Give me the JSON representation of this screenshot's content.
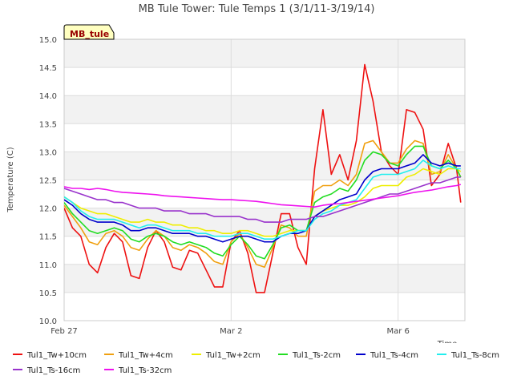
{
  "chart_data": {
    "type": "line",
    "title": "MB Tule Tower: Tule Temps 1 (3/1/11-3/19/14)",
    "xlabel": "Time",
    "ylabel": "Temperature (C)",
    "ylim": [
      10.0,
      15.0
    ],
    "xlim": [
      0,
      9.6
    ],
    "yticks": [
      "10.0",
      "10.5",
      "11.0",
      "11.5",
      "12.0",
      "12.5",
      "13.0",
      "13.5",
      "14.0",
      "14.5",
      "15.0"
    ],
    "xticks": [
      {
        "value": 0,
        "label": "Feb 27"
      },
      {
        "value": 4,
        "label": "Mar 2"
      },
      {
        "value": 8,
        "label": "Mar 6"
      }
    ],
    "grid": true,
    "station_badge": "MB_tule",
    "legend_position": "bottom",
    "x": [
      0.0,
      0.2,
      0.4,
      0.6,
      0.8,
      1.0,
      1.2,
      1.4,
      1.6,
      1.8,
      2.0,
      2.2,
      2.4,
      2.6,
      2.8,
      3.0,
      3.2,
      3.4,
      3.6,
      3.8,
      4.0,
      4.2,
      4.4,
      4.6,
      4.8,
      5.0,
      5.2,
      5.4,
      5.6,
      5.8,
      6.0,
      6.2,
      6.4,
      6.6,
      6.8,
      7.0,
      7.2,
      7.4,
      7.6,
      7.8,
      8.0,
      8.2,
      8.4,
      8.6,
      8.8,
      9.0,
      9.2,
      9.4,
      9.5
    ],
    "series": [
      {
        "name": "Tul1_Tw+10cm",
        "color": "#ee1111",
        "values": [
          12.0,
          11.65,
          11.5,
          11.0,
          10.85,
          11.3,
          11.55,
          11.4,
          10.8,
          10.75,
          11.3,
          11.6,
          11.4,
          10.95,
          10.9,
          11.25,
          11.2,
          10.9,
          10.6,
          10.6,
          11.4,
          11.6,
          11.2,
          10.5,
          10.5,
          11.2,
          11.9,
          11.9,
          11.3,
          11.0,
          12.7,
          13.75,
          12.6,
          12.95,
          12.5,
          13.2,
          14.55,
          13.9,
          13.0,
          12.75,
          12.6,
          13.75,
          13.7,
          13.4,
          12.4,
          12.6,
          13.15,
          12.7,
          12.1
        ]
      },
      {
        "name": "Tul1_Tw+4cm",
        "color": "#f0a010",
        "values": [
          12.05,
          11.85,
          11.65,
          11.4,
          11.35,
          11.55,
          11.6,
          11.5,
          11.3,
          11.25,
          11.45,
          11.6,
          11.5,
          11.3,
          11.25,
          11.35,
          11.3,
          11.2,
          11.05,
          11.0,
          11.4,
          11.55,
          11.3,
          11.0,
          10.95,
          11.3,
          11.7,
          11.65,
          11.5,
          11.5,
          12.3,
          12.4,
          12.4,
          12.5,
          12.4,
          12.6,
          13.15,
          13.2,
          13.0,
          12.8,
          12.8,
          13.05,
          13.2,
          13.15,
          12.6,
          12.65,
          12.95,
          12.7,
          12.55
        ]
      },
      {
        "name": "Tul1_Tw+2cm",
        "color": "#eeee00",
        "values": [
          12.2,
          12.1,
          12.0,
          11.95,
          11.9,
          11.9,
          11.85,
          11.8,
          11.75,
          11.75,
          11.8,
          11.75,
          11.75,
          11.7,
          11.7,
          11.65,
          11.65,
          11.6,
          11.6,
          11.55,
          11.55,
          11.6,
          11.6,
          11.55,
          11.5,
          11.5,
          11.55,
          11.6,
          11.6,
          11.6,
          11.85,
          11.95,
          12.0,
          12.05,
          12.05,
          12.1,
          12.2,
          12.35,
          12.4,
          12.4,
          12.4,
          12.55,
          12.6,
          12.7,
          12.65,
          12.6,
          12.7,
          12.7,
          12.65
        ]
      },
      {
        "name": "Tul1_Ts-2cm",
        "color": "#22dd22",
        "values": [
          12.1,
          11.9,
          11.75,
          11.6,
          11.55,
          11.6,
          11.65,
          11.6,
          11.45,
          11.4,
          11.5,
          11.55,
          11.5,
          11.4,
          11.35,
          11.4,
          11.35,
          11.3,
          11.2,
          11.15,
          11.35,
          11.5,
          11.35,
          11.15,
          11.1,
          11.35,
          11.65,
          11.7,
          11.6,
          11.6,
          12.1,
          12.2,
          12.25,
          12.35,
          12.3,
          12.5,
          12.85,
          13.0,
          12.95,
          12.8,
          12.75,
          12.95,
          13.1,
          13.1,
          12.75,
          12.7,
          12.85,
          12.7,
          12.55
        ]
      },
      {
        "name": "Tul1_Ts-4cm",
        "color": "#0000cc",
        "values": [
          12.15,
          12.05,
          11.9,
          11.8,
          11.75,
          11.75,
          11.75,
          11.7,
          11.6,
          11.6,
          11.65,
          11.65,
          11.6,
          11.55,
          11.55,
          11.55,
          11.5,
          11.5,
          11.45,
          11.4,
          11.45,
          11.5,
          11.5,
          11.45,
          11.4,
          11.4,
          11.5,
          11.55,
          11.55,
          11.6,
          11.85,
          11.95,
          12.05,
          12.15,
          12.2,
          12.25,
          12.5,
          12.65,
          12.7,
          12.7,
          12.7,
          12.75,
          12.8,
          12.95,
          12.8,
          12.75,
          12.8,
          12.75,
          12.75
        ]
      },
      {
        "name": "Tul1_Ts-8cm",
        "color": "#22eeee",
        "values": [
          12.2,
          12.1,
          11.95,
          11.85,
          11.8,
          11.8,
          11.8,
          11.75,
          11.7,
          11.65,
          11.7,
          11.7,
          11.65,
          11.6,
          11.6,
          11.6,
          11.55,
          11.55,
          11.5,
          11.5,
          11.5,
          11.55,
          11.55,
          11.5,
          11.45,
          11.45,
          11.5,
          11.55,
          11.6,
          11.6,
          11.8,
          11.9,
          11.95,
          12.05,
          12.1,
          12.15,
          12.35,
          12.55,
          12.6,
          12.6,
          12.6,
          12.65,
          12.7,
          12.85,
          12.75,
          12.7,
          12.75,
          12.7,
          12.7
        ]
      },
      {
        "name": "Tul1_Ts-16cm",
        "color": "#9933cc",
        "values": [
          12.35,
          12.3,
          12.25,
          12.2,
          12.15,
          12.15,
          12.1,
          12.1,
          12.05,
          12.0,
          12.0,
          12.0,
          11.95,
          11.95,
          11.95,
          11.9,
          11.9,
          11.9,
          11.85,
          11.85,
          11.85,
          11.85,
          11.8,
          11.8,
          11.75,
          11.75,
          11.75,
          11.8,
          11.8,
          11.8,
          11.85,
          11.85,
          11.9,
          11.95,
          12.0,
          12.05,
          12.1,
          12.15,
          12.2,
          12.25,
          12.25,
          12.3,
          12.35,
          12.4,
          12.45,
          12.45,
          12.5,
          12.55,
          12.55
        ]
      },
      {
        "name": "Tul1_Ts-32cm",
        "color": "#ee11ee",
        "values": [
          12.38,
          12.35,
          12.35,
          12.33,
          12.35,
          12.33,
          12.3,
          12.28,
          12.27,
          12.26,
          12.25,
          12.24,
          12.22,
          12.21,
          12.2,
          12.19,
          12.18,
          12.17,
          12.16,
          12.15,
          12.15,
          12.14,
          12.13,
          12.12,
          12.1,
          12.08,
          12.06,
          12.05,
          12.04,
          12.03,
          12.02,
          12.05,
          12.07,
          12.08,
          12.1,
          12.12,
          12.14,
          12.16,
          12.18,
          12.2,
          12.22,
          12.25,
          12.28,
          12.3,
          12.32,
          12.35,
          12.38,
          12.4,
          12.42
        ]
      }
    ]
  }
}
